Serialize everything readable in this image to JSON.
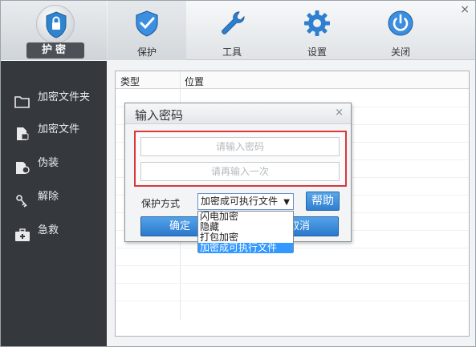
{
  "app": {
    "logo_text": "护密",
    "close_glyph": "×"
  },
  "tabs": [
    {
      "label": "保护",
      "icon": "shield-icon",
      "active": true
    },
    {
      "label": "工具",
      "icon": "wrench-icon",
      "active": false
    },
    {
      "label": "设置",
      "icon": "gear-icon",
      "active": false
    },
    {
      "label": "关闭",
      "icon": "power-icon",
      "active": false
    }
  ],
  "sidebar": {
    "items": [
      {
        "label": "加密文件夹",
        "icon": "folder-icon"
      },
      {
        "label": "加密文件",
        "icon": "file-icon"
      },
      {
        "label": "伪装",
        "icon": "mask-icon"
      },
      {
        "label": "解除",
        "icon": "key-icon"
      },
      {
        "label": "急救",
        "icon": "first-aid-kit-icon"
      }
    ]
  },
  "list": {
    "columns": [
      "类型",
      "位置"
    ]
  },
  "dialog": {
    "title": "输入密码",
    "close_glyph": "×",
    "password_placeholder": "请输入密码",
    "confirm_placeholder": "请再输入一次",
    "mode_label": "保护方式",
    "selected_mode": "加密成可执行文件",
    "help_label": "帮助",
    "ok_label": "确定",
    "cancel_label": "取消",
    "mode_options": [
      "闪电加密",
      "隐藏",
      "打包加密",
      "加密成可执行文件"
    ],
    "selected_index": 3
  },
  "colors": {
    "sidebar_bg": "#35393e",
    "accent_blue": "#2f7fd0",
    "highlight_red": "#d9383a",
    "selection_blue": "#3399ff"
  }
}
